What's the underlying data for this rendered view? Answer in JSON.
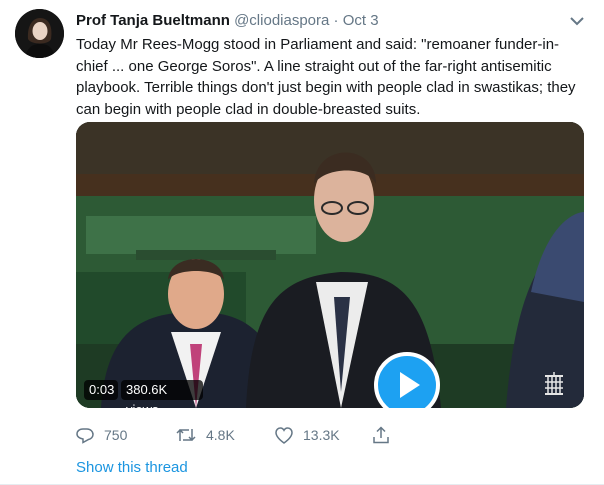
{
  "tweet": {
    "display_name": "Prof Tanja Bueltmann",
    "handle": "@cliodiaspora",
    "separator": "·",
    "date": "Oct 3",
    "text": "Today Mr Rees-Mogg stood in Parliament and said: \"remoaner funder-in-chief ... one George Soros\". A line straight out of the far-right antisemitic playbook. Terrible things don't just begin with people clad in swastikas; they can begin with people clad in double-breasted suits."
  },
  "video": {
    "duration": "0:03",
    "views": "380.6K views"
  },
  "actions": {
    "replies": "750",
    "retweets": "4.8K",
    "likes": "13.3K"
  },
  "thread_link": "Show this thread",
  "colors": {
    "accent": "#1da1f2",
    "link": "#1b95e0",
    "muted": "#657786",
    "text": "#14171a"
  },
  "icons": [
    "avatar-photo",
    "chevron-down-icon",
    "play-icon",
    "reply-icon",
    "retweet-icon",
    "like-icon",
    "share-icon",
    "parliament-portcullis-icon"
  ]
}
